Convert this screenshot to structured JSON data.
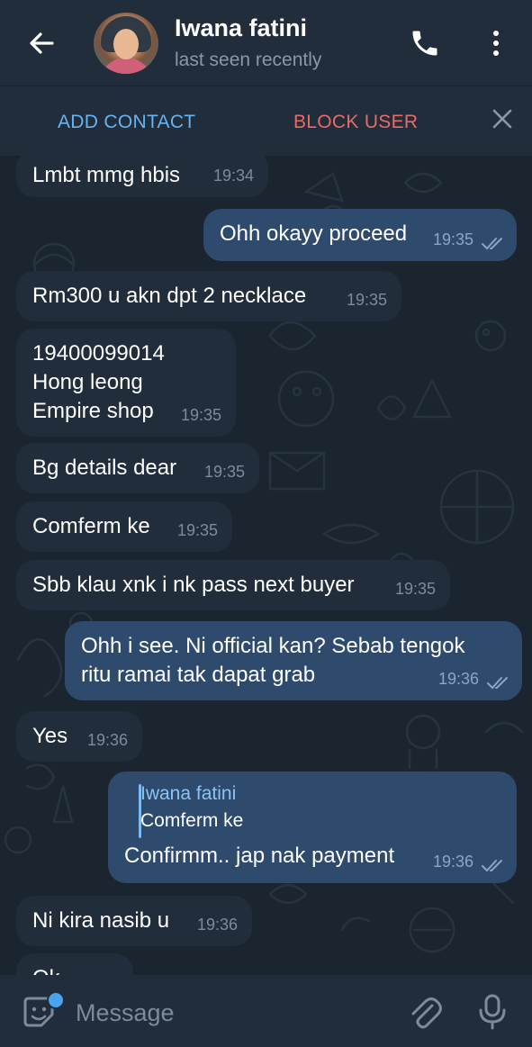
{
  "header": {
    "contact_name": "Iwana fatini",
    "status": "last seen recently"
  },
  "actions": {
    "add_contact": "ADD CONTACT",
    "block_user": "BLOCK USER"
  },
  "messages": [
    {
      "dir": "in",
      "text": "Lmbt mmg hbis",
      "time": "19:34"
    },
    {
      "dir": "out",
      "text": "Ohh okayy proceed",
      "time": "19:35",
      "status": "read"
    },
    {
      "dir": "in",
      "text": "Rm300 u akn dpt 2 necklace",
      "time": "19:35"
    },
    {
      "dir": "in",
      "text": "19400099014\nHong leong\nEmpire shop",
      "time": "19:35"
    },
    {
      "dir": "in",
      "text": "Bg details dear",
      "time": "19:35"
    },
    {
      "dir": "in",
      "text": "Comferm ke",
      "time": "19:35"
    },
    {
      "dir": "in",
      "text": "Sbb klau xnk i nk pass next buyer",
      "time": "19:35"
    },
    {
      "dir": "out",
      "text": "Ohh i see. Ni official kan? Sebab tengok\nritu ramai tak dapat grab",
      "time": "19:36",
      "status": "read"
    },
    {
      "dir": "in",
      "text": "Yes",
      "time": "19:36"
    },
    {
      "dir": "out",
      "reply_name": "Iwana fatini",
      "reply_text": "Comferm ke",
      "text": "Confirmm.. jap nak payment",
      "time": "19:36",
      "status": "read"
    },
    {
      "dir": "in",
      "text": "Ni kira nasib u",
      "time": "19:36"
    },
    {
      "dir": "in",
      "text": "Ok",
      "time": ""
    }
  ],
  "composer": {
    "placeholder": "Message"
  },
  "icons": {
    "back": "arrow-left-icon",
    "call": "phone-icon",
    "more": "more-vertical-icon",
    "close": "close-icon",
    "emoji": "sticker-emoji-icon",
    "attach": "paperclip-icon",
    "mic": "microphone-icon",
    "read": "double-check-icon"
  },
  "colors": {
    "header_bg": "#212d3b",
    "chat_bg": "#1b2530",
    "incoming_bubble": "#212d3b",
    "outgoing_bubble": "#2e4a6d",
    "accent_blue": "#64b3f2",
    "danger_red": "#e56a6a"
  }
}
